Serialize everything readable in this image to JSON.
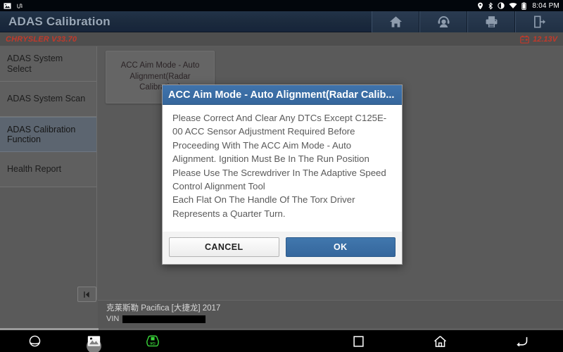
{
  "statusbar": {
    "left_icons": [
      "screenshot-icon",
      "usb-icon"
    ],
    "right_icons": [
      "location-icon",
      "bluetooth-icon",
      "contrast-icon",
      "wifi-icon",
      "battery-icon"
    ],
    "time": "8:04 PM"
  },
  "header": {
    "title": "ADAS Calibration",
    "actions": [
      {
        "name": "home-icon",
        "label": "Home"
      },
      {
        "name": "support-icon",
        "label": "Support"
      },
      {
        "name": "print-icon",
        "label": "Print"
      },
      {
        "name": "exit-icon",
        "label": "Exit"
      }
    ]
  },
  "subbar": {
    "brand": "CHRYSLER V33.70",
    "voltage": "12.13V",
    "battery_icon": "battery-voltage-icon"
  },
  "sidebar": {
    "items": [
      {
        "label": "ADAS System Select",
        "selected": false
      },
      {
        "label": "ADAS System Scan",
        "selected": false
      },
      {
        "label": "ADAS Calibration Function",
        "selected": true
      },
      {
        "label": "Health Report",
        "selected": false
      }
    ],
    "collapse_icon": "collapse-left-icon"
  },
  "main": {
    "card": {
      "label": "ACC Aim Mode - Auto Alignment(Radar Calibration)"
    }
  },
  "vehicle": {
    "name": "克莱斯勒 Pacifica [大捷龙] 2017",
    "vin_label": "VIN",
    "vin_value": ""
  },
  "dialog": {
    "title": "ACC Aim Mode - Auto Alignment(Radar Calib...",
    "body": "Please Correct And Clear Any DTCs Except C125E-00 ACC Sensor Adjustment Required Before Proceeding With The ACC Aim Mode - Auto Alignment.  Ignition Must Be In The Run Position\nPlease Use The Screwdriver In The Adaptive Speed Control Alignment Tool\nEach Flat On The Handle Of The Torx Driver Represents a Quarter Turn.",
    "cancel_label": "CANCEL",
    "ok_label": "OK"
  },
  "navbar": {
    "buttons": [
      {
        "name": "browser-icon"
      },
      {
        "name": "screenshot-icon"
      },
      {
        "name": "vci-icon"
      },
      {
        "name": "recents-icon"
      },
      {
        "name": "home-nav-icon"
      },
      {
        "name": "back-icon"
      }
    ]
  },
  "colors": {
    "accent_blue": "#3a6ea5",
    "brand_red": "#c1392b",
    "vci_green": "#3ad63a",
    "titlebar": "#1b2a3d",
    "body_gray": "#5a5a5a"
  }
}
